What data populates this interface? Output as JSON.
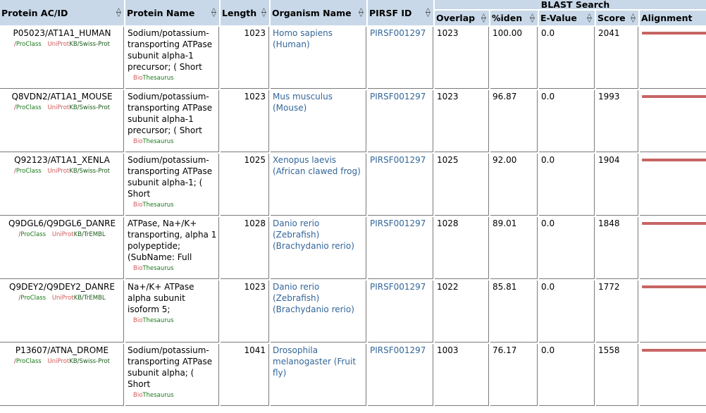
{
  "table": {
    "headers": {
      "protein_ac_id": "Protein AC/ID",
      "protein_name": "Protein Name",
      "length": "Length",
      "organism_name": "Organism Name",
      "pirsf_id": "PIRSF ID",
      "blast_group": "BLAST Search",
      "overlap": "Overlap",
      "iden": "%iden",
      "evalue": "E-Value",
      "score": "Score",
      "alignment": "Alignment"
    },
    "rows": [
      {
        "ac_id": "P05023/AT1A1_HUMAN",
        "proclass": "ProClass",
        "uniprot": "UniProt",
        "kb": "KB/Swiss-Prot",
        "protein_name": "Sodium/potassium-transporting ATPase subunit alpha-1 precursor; ( Short",
        "bio": "Bio",
        "thes": "Thesaurus",
        "length": "1023",
        "organism": "Homo sapiens (Human)",
        "pirsf": "PIRSF001297",
        "overlap": "1023",
        "iden": "100.00",
        "evalue": "0.0",
        "score": "2041",
        "alignment_fraction": 1.0
      },
      {
        "ac_id": "Q8VDN2/AT1A1_MOUSE",
        "proclass": "ProClass",
        "uniprot": "UniProt",
        "kb": "KB/Swiss-Prot",
        "protein_name": "Sodium/potassium-transporting ATPase subunit alpha-1 precursor; ( Short",
        "bio": "Bio",
        "thes": "Thesaurus",
        "length": "1023",
        "organism": "Mus musculus (Mouse)",
        "pirsf": "PIRSF001297",
        "overlap": "1023",
        "iden": "96.87",
        "evalue": "0.0",
        "score": "1993",
        "alignment_fraction": 1.0
      },
      {
        "ac_id": "Q92123/AT1A1_XENLA",
        "proclass": "ProClass",
        "uniprot": "UniProt",
        "kb": "KB/Swiss-Prot",
        "protein_name": "Sodium/potassium-transporting ATPase subunit alpha-1; ( Short",
        "bio": "Bio",
        "thes": "Thesaurus",
        "length": "1025",
        "organism": "Xenopus laevis (African clawed frog)",
        "pirsf": "PIRSF001297",
        "overlap": "1025",
        "iden": "92.00",
        "evalue": "0.0",
        "score": "1904",
        "alignment_fraction": 1.0
      },
      {
        "ac_id": "Q9DGL6/Q9DGL6_DANRE",
        "proclass": "ProClass",
        "uniprot": "UniProt",
        "kb": "KB/TrEMBL",
        "protein_name": "ATPase, Na+/K+ transporting, alpha 1 polypeptide; (SubName: Full",
        "bio": "Bio",
        "thes": "Thesaurus",
        "length": "1028",
        "organism": "Danio rerio (Zebrafish) (Brachydanio rerio)",
        "pirsf": "PIRSF001297",
        "overlap": "1028",
        "iden": "89.01",
        "evalue": "0.0",
        "score": "1848",
        "alignment_fraction": 1.0
      },
      {
        "ac_id": "Q9DEY2/Q9DEY2_DANRE",
        "proclass": "ProClass",
        "uniprot": "UniProt",
        "kb": "KB/TrEMBL",
        "protein_name": "Na+/K+ ATPase alpha subunit isoform 5;",
        "bio": "Bio",
        "thes": "Thesaurus",
        "length": "1023",
        "organism": "Danio rerio (Zebrafish) (Brachydanio rerio)",
        "pirsf": "PIRSF001297",
        "overlap": "1022",
        "iden": "85.81",
        "evalue": "0.0",
        "score": "1772",
        "alignment_fraction": 1.0
      },
      {
        "ac_id": "P13607/ATNA_DROME",
        "proclass": "ProClass",
        "uniprot": "UniProt",
        "kb": "KB/Swiss-Prot",
        "protein_name": "Sodium/potassium-transporting ATPase subunit alpha; ( Short",
        "bio": "Bio",
        "thes": "Thesaurus",
        "length": "1041",
        "organism": "Drosophila melanogaster (Fruit fly)",
        "pirsf": "PIRSF001297",
        "overlap": "1003",
        "iden": "76.17",
        "evalue": "0.0",
        "score": "1558",
        "alignment_fraction": 1.0
      }
    ]
  },
  "colors": {
    "header_bg": "#c8d8e8",
    "link": "#336699",
    "alignment_bar": "#c86464",
    "proclass": "#1a7a1a",
    "uniprot": "#d05a5a"
  }
}
